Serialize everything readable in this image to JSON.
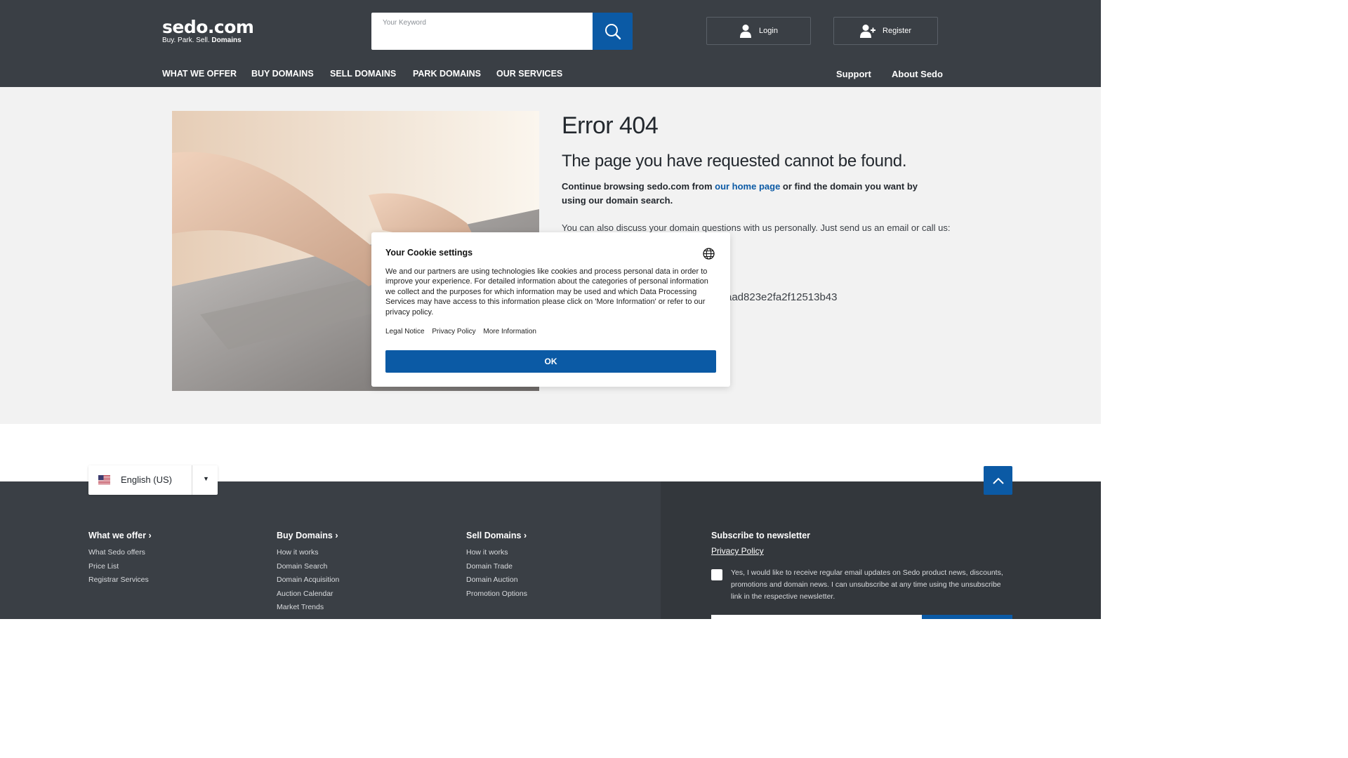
{
  "header": {
    "logo_main": "sedo.com",
    "logo_tagline": "Buy. Park. Sell.",
    "logo_tagline_bold": "Domains",
    "search_placeholder": "Your Keyword",
    "login_label": "Login",
    "register_label": "Register"
  },
  "nav": {
    "items": [
      "WHAT WE OFFER",
      "BUY DOMAINS",
      "SELL DOMAINS",
      "PARK DOMAINS",
      "OUR SERVICES"
    ],
    "support": "Support",
    "about": "About Sedo"
  },
  "error": {
    "title": "Error 404",
    "subtitle": "The page you have requested cannot be found.",
    "p1_before": "Continue browsing sedo.com from ",
    "p1_link": "our home page",
    "p1_after": " or find the domain you want by using our domain search.",
    "p2": "You can also discuss your domain questions with us personally. Just send us an email or call us:",
    "hash_fragment": "aad823e2fa2f12513b43"
  },
  "cookie": {
    "title": "Your Cookie settings",
    "text": "We and our partners are using technologies like cookies and process personal data in order to improve your experience. For detailed information about the categories of personal information we collect and the purposes for which information may be used and which Data Processing Services may have access to this information please click on 'More Information' or refer to our privacy policy.",
    "links": [
      "Legal Notice",
      "Privacy Policy",
      "More Information"
    ],
    "ok_label": "OK"
  },
  "footer": {
    "language": "English (US)",
    "columns": [
      {
        "title": "What we offer",
        "links": [
          "What Sedo offers",
          "Price List",
          "Registrar Services"
        ]
      },
      {
        "title": "Buy Domains",
        "links": [
          "How it works",
          "Domain Search",
          "Domain Acquisition",
          "Auction Calendar",
          "Market Trends"
        ]
      },
      {
        "title": "Sell Domains",
        "links": [
          "How it works",
          "Domain Trade",
          "Domain Auction",
          "Promotion Options"
        ]
      }
    ],
    "newsletter": {
      "title": "Subscribe to newsletter",
      "privacy": "Privacy Policy",
      "consent": "Yes, I would like to receive regular email updates on Sedo product news, discounts, promotions and domain news. I can unsubscribe at any time using the unsubscribe link in the respective newsletter."
    }
  },
  "colors": {
    "header_bg": "#3a3f45",
    "accent_blue": "#0b5aa5",
    "main_bg": "#f2f2f2"
  },
  "icons": {
    "search": "search-icon",
    "login": "user-icon",
    "register": "user-plus-icon",
    "globe": "globe-icon",
    "flag": "us-flag-icon",
    "caret": "caret-down-icon",
    "top": "chevron-up-icon",
    "chevron": "chevron-right-icon"
  }
}
